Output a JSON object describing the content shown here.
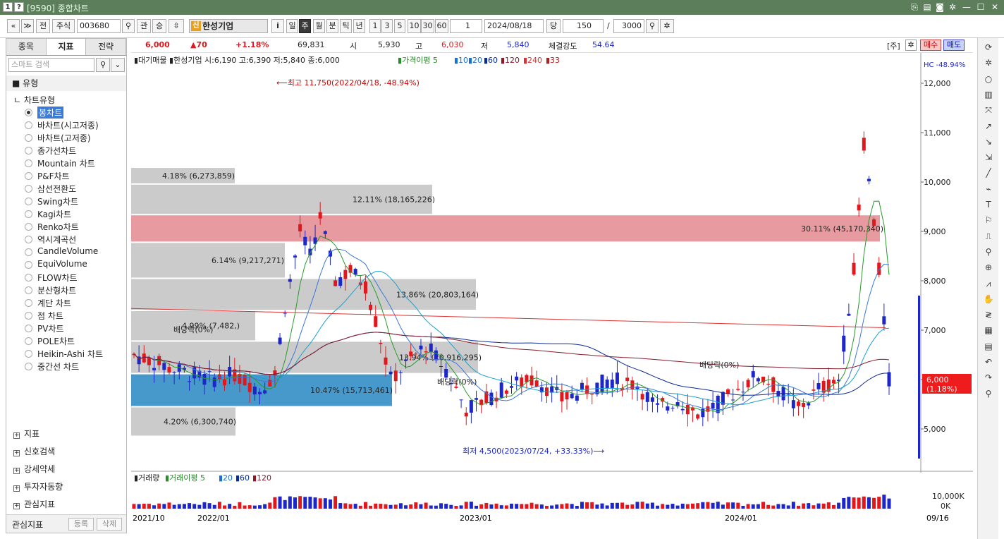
{
  "window": {
    "num1": "1",
    "num2": "?",
    "title": "[9590] 종합차트"
  },
  "toolbar": {
    "nav_back": "«",
    "nav_menu": "≫",
    "btn_jeon": "전",
    "type": "주식",
    "code": "003680",
    "btn_gwan": "관",
    "btn_up": "⇳",
    "stock_badge": "신",
    "stock_name": "한성기업",
    "info_btn": "i",
    "periods": [
      "일",
      "주",
      "월",
      "분",
      "틱",
      "년"
    ],
    "active_period": "주",
    "nums": [
      "1",
      "3",
      "5",
      "10",
      "30",
      "60"
    ],
    "count": "1",
    "date": "2024/08/18",
    "btn_dang": "당",
    "qty": "150",
    "slash": "/",
    "total": "3000"
  },
  "left": {
    "tabs": [
      "종목",
      "지표",
      "전략"
    ],
    "active_tab": "지표",
    "search_placeholder": "스마트 검색",
    "section": "유형",
    "group": "차트유형",
    "items": [
      "봉차트",
      "바차트(시고저종)",
      "바차트(고저종)",
      "종가선차트",
      "Mountain 차트",
      "P&F차트",
      "삼선전환도",
      "Swing차트",
      "Kagi차트",
      "Renko차트",
      "역시계곡선",
      "CandleVolume",
      "EquiVolume",
      "FLOW차트",
      "분산형차트",
      "계단 차트",
      "점 차트",
      "PV차트",
      "POLE차트",
      "Heikin-Ashi 차트",
      "중간선 차트"
    ],
    "bottom": [
      "지표",
      "신호검색",
      "강세약세",
      "투자자동향",
      "관심지표"
    ],
    "footer": {
      "label": "관심지표",
      "reg": "등록",
      "del": "삭제"
    }
  },
  "quote": {
    "price": "6,000",
    "change": "▲70",
    "pct": "+1.18%",
    "volume": "69,831",
    "open_l": "시",
    "open": "5,930",
    "high_l": "고",
    "high": "6,030",
    "low_l": "저",
    "low": "5,840",
    "str_l": "체결강도",
    "str": "54.64",
    "ju": "[주]",
    "buy": "매수",
    "sell": "매도"
  },
  "chart_header": {
    "title": "▮대기매물 ▮한성기업 시:6,190 고:6,390 저:5,840 종:6,000",
    "ma_label": "▮가격이평 5",
    "ma": [
      "10",
      "20",
      "60",
      "120",
      "240",
      "33"
    ],
    "hc": "HC -48.94%"
  },
  "colors": {
    "up": "#e0181e",
    "down": "#1d27c8",
    "accent": "#3b7bd8"
  },
  "annotations": {
    "high": "⟵최고 11,750(2022/04/18, -48.94%)",
    "low": "최저 4,500(2023/07/24, +33.33%)⟶",
    "div1": "배당락(0%)",
    "div2": "배당락(0%)",
    "div3": "배당락(0%)",
    "cur_price": "6,000",
    "cur_pct": "(1.18%)"
  },
  "chart_data": {
    "type": "candlestick",
    "y_axis": [
      "12,000",
      "11,000",
      "10,000",
      "9,000",
      "8,000",
      "7,000",
      "6,000",
      "5,000"
    ],
    "x_axis": [
      "2021/10",
      "2022/01",
      "2023/01",
      "2024/01",
      "09/16"
    ],
    "ylim": [
      4300,
      12300
    ],
    "volume_profile": [
      {
        "lo": 9960,
        "hi": 10300,
        "label": "4.18% (6,273,859)"
      },
      {
        "lo": 9340,
        "hi": 9960,
        "label": "12.11% (18,165,226)"
      },
      {
        "lo": 8780,
        "hi": 9340,
        "label": "30.11% (45,170,340)"
      },
      {
        "lo": 8050,
        "hi": 8780,
        "label": "6.14% (9,217,271)"
      },
      {
        "lo": 7400,
        "hi": 8050,
        "label": "13.86% (20,803,164)"
      },
      {
        "lo": 6780,
        "hi": 7400,
        "label": "4.99% (7,482,)"
      },
      {
        "lo": 6120,
        "hi": 6780,
        "label": "13.94% (20,916,295)"
      },
      {
        "lo": 5450,
        "hi": 6120,
        "label": "10.47% (15,713,461)"
      },
      {
        "lo": 4850,
        "hi": 5450,
        "label": "4.20% (6,300,740)"
      }
    ],
    "volume_header": {
      "title": "▮거래량",
      "ma_label": "▮거래이평 5",
      "ma": [
        "20",
        "60",
        "120"
      ],
      "ticks": [
        "10,000K",
        "0K"
      ]
    }
  }
}
